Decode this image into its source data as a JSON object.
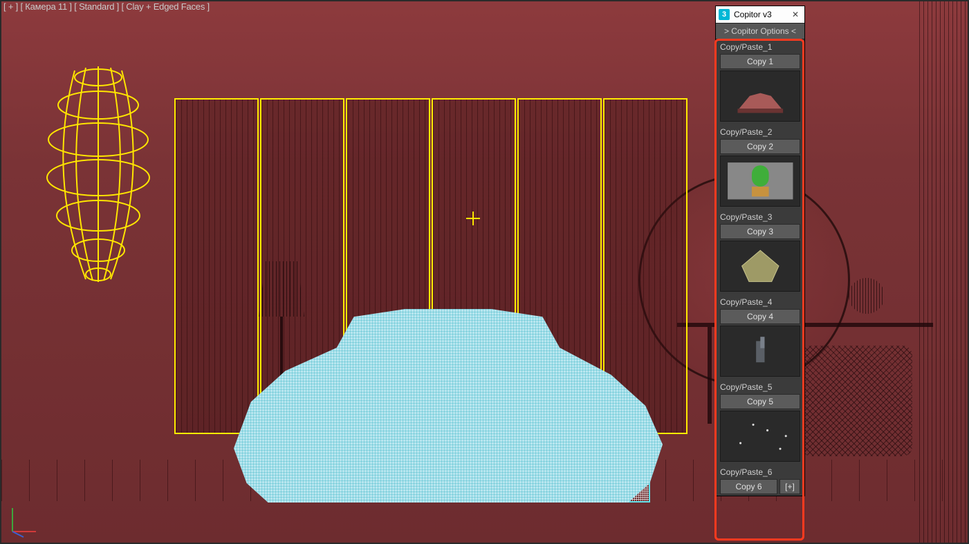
{
  "viewport": {
    "label": "[ + ] [ Камера 11 ] [ Standard ] [ Clay + Edged Faces ]"
  },
  "panel": {
    "title": "Copitor v3",
    "app_icon_letter": "3",
    "close_glyph": "✕",
    "options_label": "> Copitor Options <",
    "plus_label": "[+]",
    "slots": [
      {
        "label": "Copy/Paste_1",
        "button": "Copy 1"
      },
      {
        "label": "Copy/Paste_2",
        "button": "Copy 2"
      },
      {
        "label": "Copy/Paste_3",
        "button": "Copy 3"
      },
      {
        "label": "Copy/Paste_4",
        "button": "Copy 4"
      },
      {
        "label": "Copy/Paste_5",
        "button": "Copy 5"
      },
      {
        "label": "Copy/Paste_6",
        "button": "Copy 6"
      }
    ]
  },
  "colors": {
    "selection_cyan": "#60dfe8",
    "helper_yellow": "#ffec00",
    "panel_bg": "#3b3b3b"
  }
}
